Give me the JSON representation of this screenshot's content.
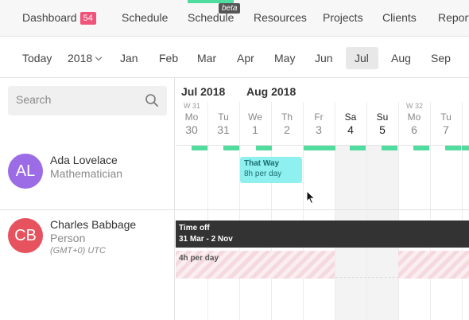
{
  "topnav": {
    "dashboard": "Dashboard",
    "dashboard_badge": "54",
    "schedule": "Schedule",
    "schedule_beta": "Schedule",
    "beta_tag": "beta",
    "resources": "Resources",
    "projects": "Projects",
    "clients": "Clients",
    "reports": "Reports"
  },
  "monthbar": {
    "today": "Today",
    "year": "2018",
    "months": [
      "Jan",
      "Feb",
      "Mar",
      "Apr",
      "May",
      "Jun",
      "Jul",
      "Aug",
      "Sep"
    ],
    "selected_month": "Jul"
  },
  "search": {
    "placeholder": "Search"
  },
  "people": [
    {
      "initials": "AL",
      "name": "Ada Lovelace",
      "role": "Mathematician",
      "color": "#9c6ce6"
    },
    {
      "initials": "CB",
      "name": "Charles Babbage",
      "role": "Person",
      "timezone": "(GMT+0) UTC",
      "color": "#e6535f"
    }
  ],
  "calendar": {
    "month_labels": [
      "Jul 2018",
      "Aug 2018"
    ],
    "week_labels": [
      "W 31",
      "W 32"
    ],
    "days": [
      {
        "name": "Mo",
        "num": "30",
        "week": "W 31"
      },
      {
        "name": "Tu",
        "num": "31"
      },
      {
        "name": "We",
        "num": "1"
      },
      {
        "name": "Th",
        "num": "2"
      },
      {
        "name": "Fr",
        "num": "3"
      },
      {
        "name": "Sa",
        "num": "4"
      },
      {
        "name": "Su",
        "num": "5"
      },
      {
        "name": "Mo",
        "num": "6",
        "week": "W 32"
      },
      {
        "name": "Tu",
        "num": "7"
      }
    ],
    "task": {
      "title": "That Way",
      "hours": "8h per day",
      "color": "#8ff1ef"
    },
    "timeoff": {
      "title": "Time off",
      "range": "31 Mar - 2 Nov"
    },
    "capacity_label": "4h per day",
    "availability_color": "#4fdc9e"
  }
}
